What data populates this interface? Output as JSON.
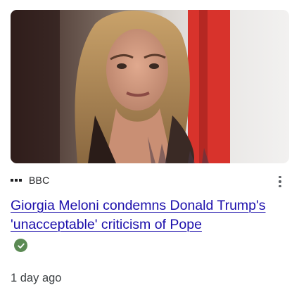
{
  "article": {
    "source": "BBC",
    "headline": "Giorgia Meloni condemns Donald Trump's 'unacceptable' criticism of Pope",
    "time": "1 day ago",
    "image_icon": "news-photo",
    "verified_icon": "check-circle-icon",
    "more_icon": "more-vert-icon"
  },
  "colors": {
    "headline_link": "#1a0dab",
    "verified_badge": "#5b8a54",
    "text_secondary": "#3c4043"
  }
}
